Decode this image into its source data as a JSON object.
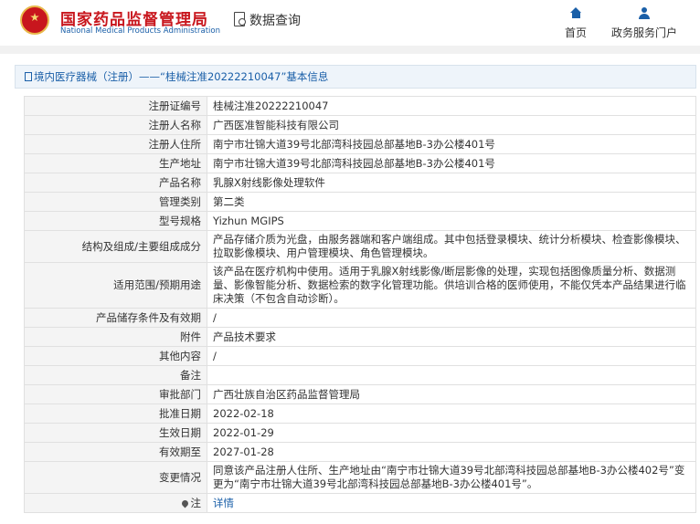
{
  "header": {
    "org_name_cn": "国家药品监督管理局",
    "org_name_en": "National Medical Products Administration",
    "data_query": "数据查询",
    "nav": [
      {
        "label": "首页",
        "icon": "home-icon"
      },
      {
        "label": "政务服务门户",
        "icon": "user-icon"
      }
    ]
  },
  "breadcrumb": "境内医疗器械（注册）——“桂械注准20222210047”基本信息",
  "rows": [
    {
      "key": "注册证编号",
      "value": "桂械注准20222210047"
    },
    {
      "key": "注册人名称",
      "value": "广西医准智能科技有限公司"
    },
    {
      "key": "注册人住所",
      "value": "南宁市壮锦大道39号北部湾科技园总部基地B-3办公楼401号"
    },
    {
      "key": "生产地址",
      "value": "南宁市壮锦大道39号北部湾科技园总部基地B-3办公楼401号"
    },
    {
      "key": "产品名称",
      "value": "乳腺X射线影像处理软件"
    },
    {
      "key": "管理类别",
      "value": "第二类"
    },
    {
      "key": "型号规格",
      "value": "Yizhun MGIPS"
    },
    {
      "key": "结构及组成/主要组成成分",
      "value": "产品存储介质为光盘，由服务器端和客户端组成。其中包括登录模块、统计分析模块、检查影像模块、拉取影像模块、用户管理模块、角色管理模块。"
    },
    {
      "key": "适用范围/预期用途",
      "value": "该产品在医疗机构中使用。适用于乳腺X射线影像/断层影像的处理，实现包括图像质量分析、数据测量、影像智能分析、数据检索的数字化管理功能。供培训合格的医师使用，不能仅凭本产品结果进行临床决策（不包含自动诊断）。"
    },
    {
      "key": "产品储存条件及有效期",
      "value": "/"
    },
    {
      "key": "附件",
      "value": "产品技术要求"
    },
    {
      "key": "其他内容",
      "value": "/"
    },
    {
      "key": "备注",
      "value": ""
    },
    {
      "key": "审批部门",
      "value": "广西壮族自治区药品监督管理局"
    },
    {
      "key": "批准日期",
      "value": "2022-02-18"
    },
    {
      "key": "生效日期",
      "value": "2022-01-29"
    },
    {
      "key": "有效期至",
      "value": "2027-01-28"
    },
    {
      "key": "变更情况",
      "value": "同意该产品注册人住所、生产地址由“南宁市壮锦大道39号北部湾科技园总部基地B-3办公楼402号”变更为“南宁市壮锦大道39号北部湾科技园总部基地B-3办公楼401号”。"
    },
    {
      "key": "注",
      "value": "详情"
    }
  ]
}
